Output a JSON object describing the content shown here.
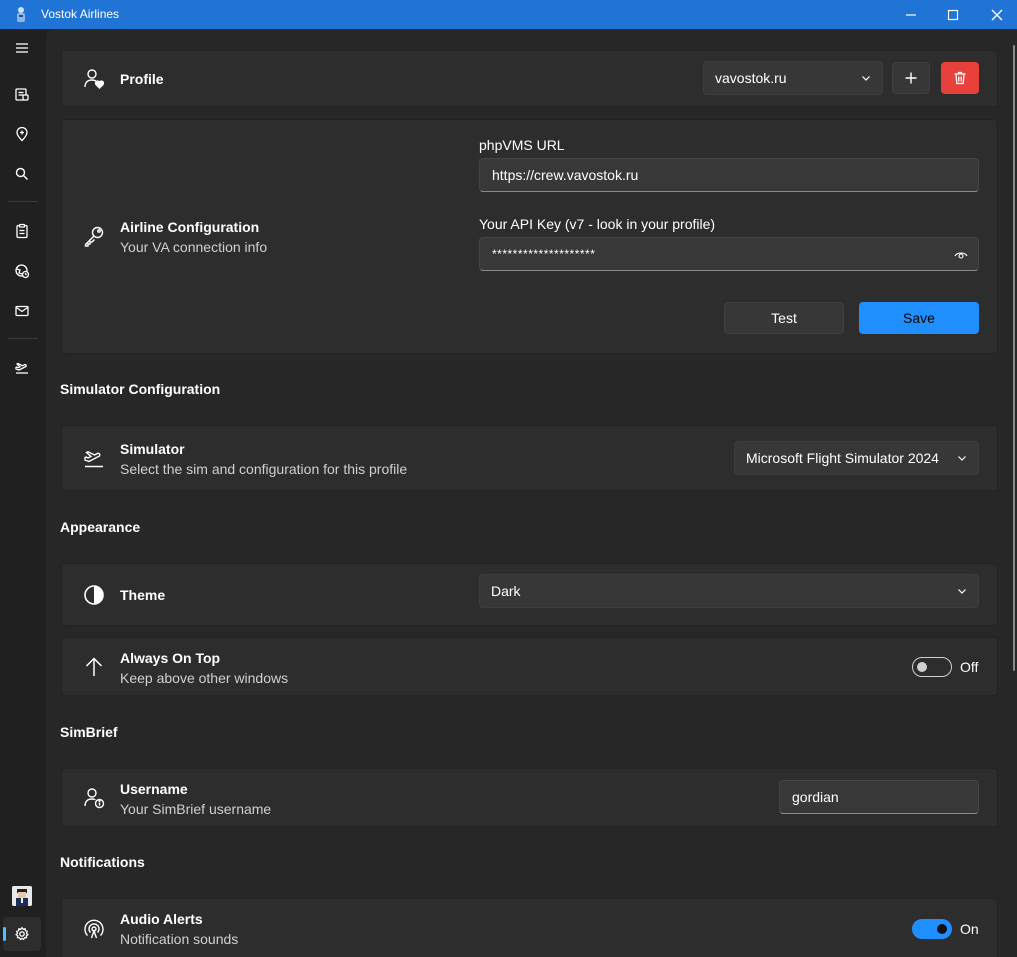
{
  "window": {
    "title": "Vostok Airlines",
    "controls": [
      "minimize-icon",
      "maximize-icon",
      "close-icon"
    ]
  },
  "sidebar": {
    "items": [
      {
        "icon": "hamburger-menu-icon"
      },
      {
        "icon": "briefcase-list-icon"
      },
      {
        "icon": "map-pin-icon"
      },
      {
        "icon": "search-icon"
      },
      {
        "icon": "clipboard-icon"
      },
      {
        "icon": "globe-clock-icon"
      },
      {
        "icon": "mail-icon"
      },
      {
        "icon": "airplane-takeoff-icon"
      },
      {
        "icon": "pilot-avatar"
      },
      {
        "icon": "gear-icon",
        "active": true
      }
    ],
    "accent": "#4cc2ff"
  },
  "profile": {
    "title": "Profile",
    "selected": "vavostok.ru",
    "add_label": "+",
    "delete_color": "#e8413c"
  },
  "airline": {
    "title": "Airline Configuration",
    "subtitle": "Your VA connection info",
    "url_label": "phpVMS URL",
    "url_value": "https://crew.vavostok.ru",
    "api_label": "Your API Key (v7 - look in your profile)",
    "api_value": "********************",
    "test_label": "Test",
    "save_label": "Save",
    "accent": "#1f8fff"
  },
  "simulator_section": {
    "heading": "Simulator Configuration",
    "title": "Simulator",
    "subtitle": "Select the sim and configuration for this profile",
    "selected": "Microsoft Flight Simulator 2024"
  },
  "appearance": {
    "heading": "Appearance",
    "theme_title": "Theme",
    "theme_selected": "Dark",
    "top_title": "Always On Top",
    "top_subtitle": "Keep above other windows",
    "top_state": "Off"
  },
  "simbrief": {
    "heading": "SimBrief",
    "title": "Username",
    "subtitle": "Your SimBrief username",
    "value": "gordian"
  },
  "notifications": {
    "heading": "Notifications",
    "title": "Audio Alerts",
    "subtitle": "Notification sounds",
    "state": "On"
  }
}
